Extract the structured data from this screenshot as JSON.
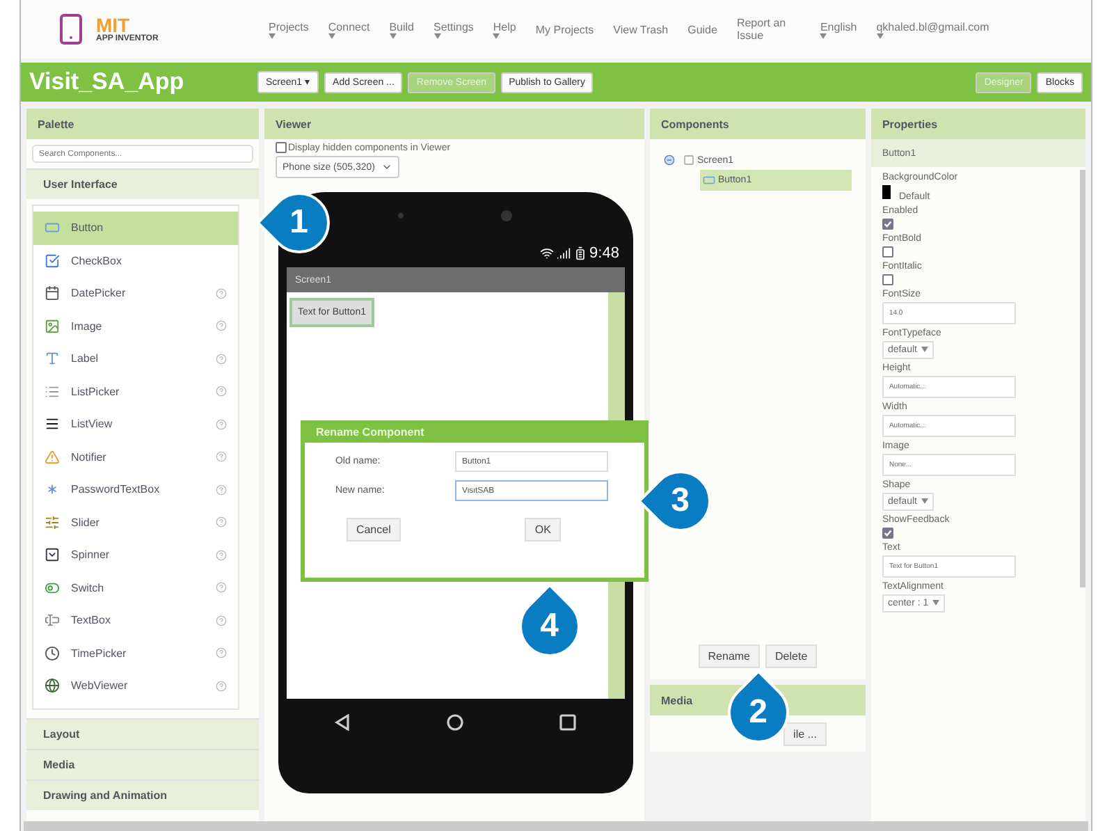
{
  "logo": {
    "title": "MIT",
    "subtitle": "APP INVENTOR"
  },
  "menu": [
    {
      "label": "Projects",
      "dropdown": true
    },
    {
      "label": "Connect",
      "dropdown": true
    },
    {
      "label": "Build",
      "dropdown": true
    },
    {
      "label": "Settings",
      "dropdown": true
    },
    {
      "label": "Help",
      "dropdown": true
    },
    {
      "label": "My Projects",
      "dropdown": false
    },
    {
      "label": "View Trash",
      "dropdown": false
    },
    {
      "label": "Guide",
      "dropdown": false
    },
    {
      "label": "Report an Issue",
      "dropdown": false
    },
    {
      "label": "English",
      "dropdown": true
    },
    {
      "label": "qkhaled.bl@gmail.com",
      "dropdown": true
    }
  ],
  "project": {
    "title": "Visit_SA_App",
    "tools": [
      {
        "label": "Screen1 ▾",
        "disabled": false
      },
      {
        "label": "Add Screen ...",
        "disabled": false
      },
      {
        "label": "Remove Screen",
        "disabled": true
      },
      {
        "label": "Publish to Gallery",
        "disabled": false
      }
    ],
    "views": [
      {
        "label": "Designer",
        "selected": true
      },
      {
        "label": "Blocks",
        "selected": false
      }
    ]
  },
  "palette": {
    "title": "Palette",
    "search": {
      "placeholder": "Search Components..."
    },
    "category": "User Interface",
    "items": [
      {
        "label": "Button",
        "selected": true,
        "help": false
      },
      {
        "label": "CheckBox",
        "selected": false,
        "help": false
      },
      {
        "label": "DatePicker",
        "selected": false,
        "help": true
      },
      {
        "label": "Image",
        "selected": false,
        "help": true
      },
      {
        "label": "Label",
        "selected": false,
        "help": true
      },
      {
        "label": "ListPicker",
        "selected": false,
        "help": true
      },
      {
        "label": "ListView",
        "selected": false,
        "help": true
      },
      {
        "label": "Notifier",
        "selected": false,
        "help": true
      },
      {
        "label": "PasswordTextBox",
        "selected": false,
        "help": true
      },
      {
        "label": "Slider",
        "selected": false,
        "help": true
      },
      {
        "label": "Spinner",
        "selected": false,
        "help": true
      },
      {
        "label": "Switch",
        "selected": false,
        "help": true
      },
      {
        "label": "TextBox",
        "selected": false,
        "help": true
      },
      {
        "label": "TimePicker",
        "selected": false,
        "help": true
      },
      {
        "label": "WebViewer",
        "selected": false,
        "help": true
      }
    ],
    "more_categories": [
      "Layout",
      "Media",
      "Drawing and Animation"
    ]
  },
  "viewer": {
    "title": "Viewer",
    "hidden_toggle": {
      "label": "Display hidden components in Viewer",
      "checked": false
    },
    "size_select": "Phone size (505,320)",
    "phone": {
      "time": "9:48",
      "screen_title": "Screen1",
      "button": "Text for Button1"
    },
    "dialog": {
      "title": "Rename Component",
      "old_label": "Old name:",
      "old_value": "Button1",
      "new_label": "New name:",
      "new_value": "VisitSAB",
      "buttons": [
        "Cancel",
        "OK"
      ]
    }
  },
  "components": {
    "title": "Components",
    "tree": [
      {
        "label": "Screen1",
        "selected": false,
        "expanded": true,
        "children": [
          {
            "label": "Button1",
            "selected": true
          }
        ]
      }
    ],
    "buttons": [
      "Rename",
      "Delete"
    ],
    "media_title": "Media",
    "upload": "ile ..."
  },
  "properties": {
    "title": "Properties",
    "component": "Button1",
    "items": [
      {
        "label": "BackgroundColor",
        "kind": "color",
        "value": "Default",
        "color": "#000000"
      },
      {
        "label": "Enabled",
        "kind": "checkbox",
        "checked": true
      },
      {
        "label": "FontBold",
        "kind": "checkbox",
        "checked": false
      },
      {
        "label": "FontItalic",
        "kind": "checkbox",
        "checked": false
      },
      {
        "label": "FontSize",
        "kind": "text",
        "value": "14.0"
      },
      {
        "label": "FontTypeface",
        "kind": "select",
        "value": "default"
      },
      {
        "label": "Height",
        "kind": "text",
        "value": "Automatic..."
      },
      {
        "label": "Width",
        "kind": "text",
        "value": "Automatic..."
      },
      {
        "label": "Image",
        "kind": "text",
        "value": "None..."
      },
      {
        "label": "Shape",
        "kind": "select",
        "value": "default"
      },
      {
        "label": "ShowFeedback",
        "kind": "checkbox",
        "checked": true
      },
      {
        "label": "Text",
        "kind": "text",
        "value": "Text for Button1"
      },
      {
        "label": "TextAlignment",
        "kind": "select",
        "value": "center : 1"
      }
    ]
  },
  "markers": [
    "1",
    "2",
    "3",
    "4"
  ]
}
